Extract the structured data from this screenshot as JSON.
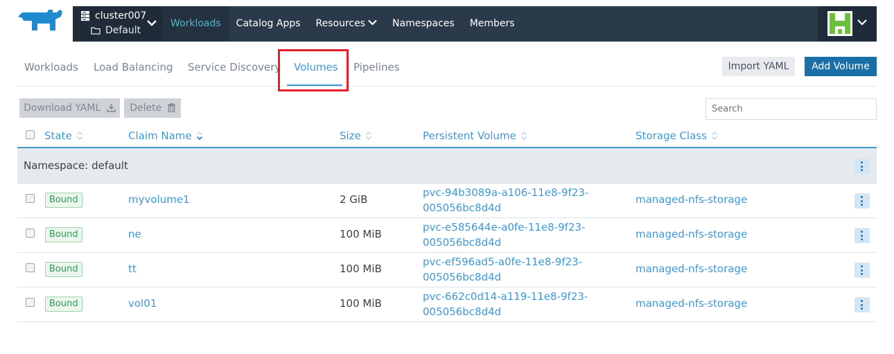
{
  "header": {
    "cluster": "cluster007",
    "project": "Default",
    "nav": [
      "Workloads",
      "Catalog Apps",
      "Resources",
      "Namespaces",
      "Members"
    ],
    "active_nav": "Workloads"
  },
  "subtabs": [
    "Workloads",
    "Load Balancing",
    "Service Discovery",
    "Volumes",
    "Pipelines"
  ],
  "active_subtab": "Volumes",
  "actions": {
    "import": "Import YAML",
    "add": "Add Volume"
  },
  "toolbar": {
    "download": "Download YAML",
    "delete": "Delete",
    "search_placeholder": "Search"
  },
  "table": {
    "columns": [
      "State",
      "Claim Name",
      "Size",
      "Persistent Volume",
      "Storage Class"
    ],
    "group": "Namespace: default",
    "rows": [
      {
        "state": "Bound",
        "claim": "myvolume1",
        "size": "2 GiB",
        "pv_line1": "pvc-94b3089a-a106-11e8-9f23-",
        "pv_line2": "005056bc8d4d",
        "storage": "managed-nfs-storage"
      },
      {
        "state": "Bound",
        "claim": "ne",
        "size": "100 MiB",
        "pv_line1": "pvc-e585644e-a0fe-11e8-9f23-",
        "pv_line2": "005056bc8d4d",
        "storage": "managed-nfs-storage"
      },
      {
        "state": "Bound",
        "claim": "tt",
        "size": "100 MiB",
        "pv_line1": "pvc-ef596ad5-a0fe-11e8-9f23-",
        "pv_line2": "005056bc8d4d",
        "storage": "managed-nfs-storage"
      },
      {
        "state": "Bound",
        "claim": "vol01",
        "size": "100 MiB",
        "pv_line1": "pvc-662c0d14-a119-11e8-9f23-",
        "pv_line2": "005056bc8d4d",
        "storage": "managed-nfs-storage"
      }
    ]
  },
  "colors": {
    "accent": "#3d98d3",
    "nav_bg": "#2b3a4a",
    "primary_button": "#1b6fa8",
    "highlight": "#e3202a",
    "bound_green": "#2f9a55"
  }
}
